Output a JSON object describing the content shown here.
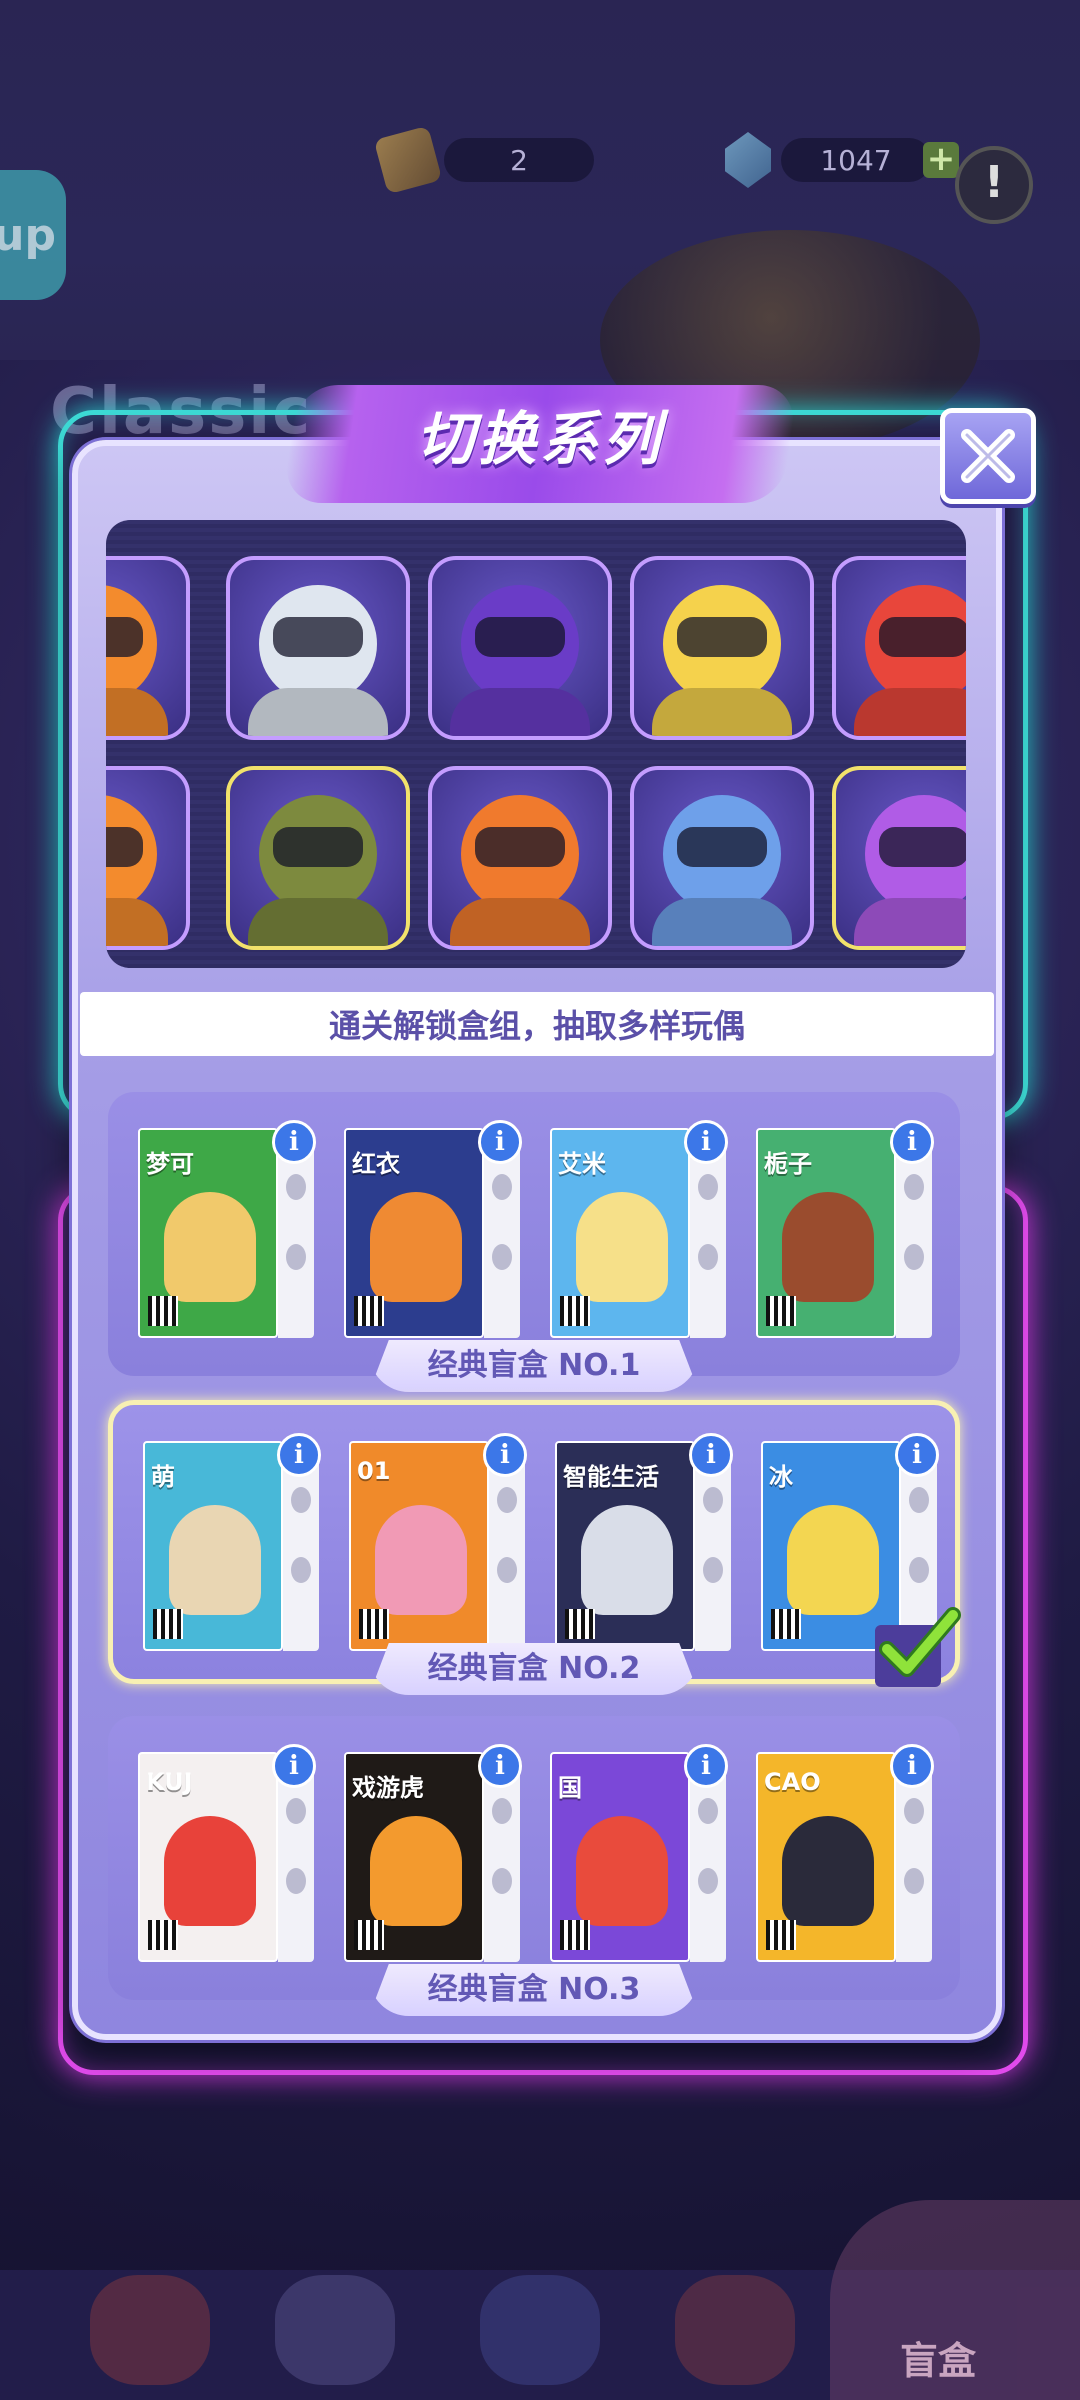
{
  "hud": {
    "ticket_count": "2",
    "gem_count": "1047",
    "plus_symbol": "+",
    "help_symbol": "!",
    "up_label": "up"
  },
  "background": {
    "classic_title": "Classic"
  },
  "modal": {
    "title": "切换系列",
    "close_icon": "close-icon",
    "unlock_hint": "通关解锁盒组，抽取多样玩偶",
    "characters_row1": [
      {
        "name": "partial-character",
        "color": "#f38b2d"
      },
      {
        "name": "robot-white",
        "color": "#dfe6ef"
      },
      {
        "name": "robot-purple",
        "color": "#6a3cc7"
      },
      {
        "name": "blonde-hoodie-boy",
        "color": "#f5d24c"
      },
      {
        "name": "goggles-boy",
        "color": "#e8463b"
      }
    ],
    "characters_row2": [
      {
        "name": "partial-character",
        "color": "#f38b2d"
      },
      {
        "name": "robot-green",
        "color": "#7d8a3e"
      },
      {
        "name": "robot-orange",
        "color": "#f07a2d"
      },
      {
        "name": "blue-hair-boy",
        "color": "#6ea0ea"
      },
      {
        "name": "purple-hair-girl",
        "color": "#b05ce6"
      }
    ],
    "series": [
      {
        "label": "经典盲盒 NO.1",
        "selected": false,
        "boxes": [
          {
            "brand": "梦可",
            "color": "#3ea847",
            "figure": "#f1c96b"
          },
          {
            "brand": "红衣",
            "color": "#2c3d8e",
            "figure": "#ef8a33"
          },
          {
            "brand": "艾米",
            "color": "#5db6ee",
            "figure": "#f6e089"
          },
          {
            "brand": "栀子",
            "color": "#46b071",
            "figure": "#9a4c2e"
          }
        ]
      },
      {
        "label": "经典盲盒 NO.2",
        "selected": true,
        "boxes": [
          {
            "brand": "萌",
            "color": "#48b8d8",
            "figure": "#e9d6b3"
          },
          {
            "brand": "01",
            "color": "#f08a2a",
            "figure": "#f19ab5"
          },
          {
            "brand": "智能生活",
            "color": "#2b2e57",
            "figure": "#d9dde8"
          },
          {
            "brand": "冰",
            "color": "#3b8de3",
            "figure": "#f3d651"
          }
        ]
      },
      {
        "label": "经典盲盒 NO.3",
        "selected": false,
        "boxes": [
          {
            "brand": "KUJ",
            "color": "#f4f0f0",
            "figure": "#e8423a"
          },
          {
            "brand": "戏游虎",
            "color": "#1f1a17",
            "figure": "#f39a2e"
          },
          {
            "brand": "国",
            "color": "#7b48d8",
            "figure": "#e94b3c"
          },
          {
            "brand": "CAO",
            "color": "#f4b62a",
            "figure": "#2a2a3a"
          }
        ]
      }
    ]
  },
  "bottom_nav": {
    "blindbox_label": "盲盒"
  }
}
